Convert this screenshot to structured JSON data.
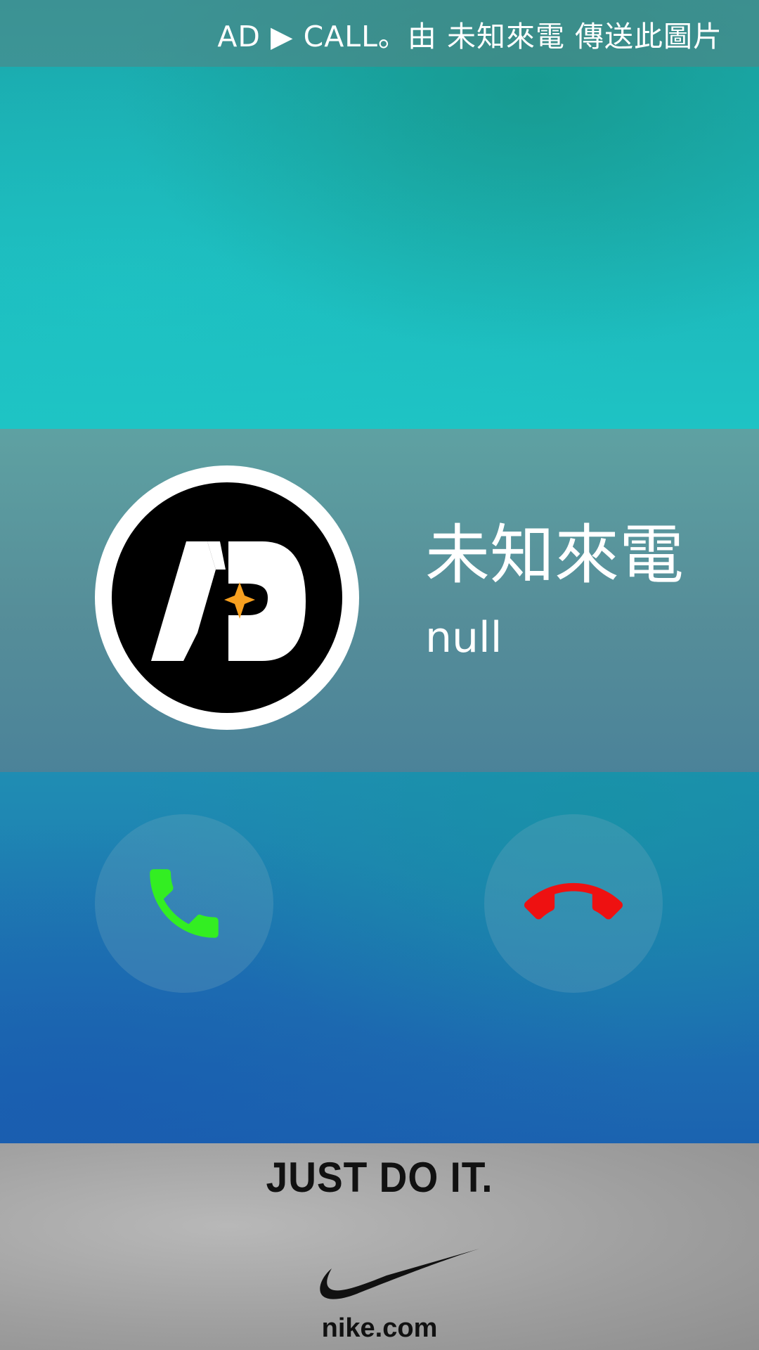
{
  "notification": {
    "text": "AD ▶ CALL。由 未知來電 傳送此圖片"
  },
  "caller": {
    "name": "未知來電",
    "number": "null",
    "avatar_logo": "AD logo"
  },
  "actions": {
    "answer_icon": "phone-answer-icon",
    "decline_icon": "phone-hangup-icon"
  },
  "ad": {
    "slogan": "JUST DO IT.",
    "url": "nike.com",
    "logo": "nike swoosh"
  },
  "colors": {
    "answer": "#33ee22",
    "decline": "#ee1111",
    "brand_orange": "#f7a020"
  }
}
